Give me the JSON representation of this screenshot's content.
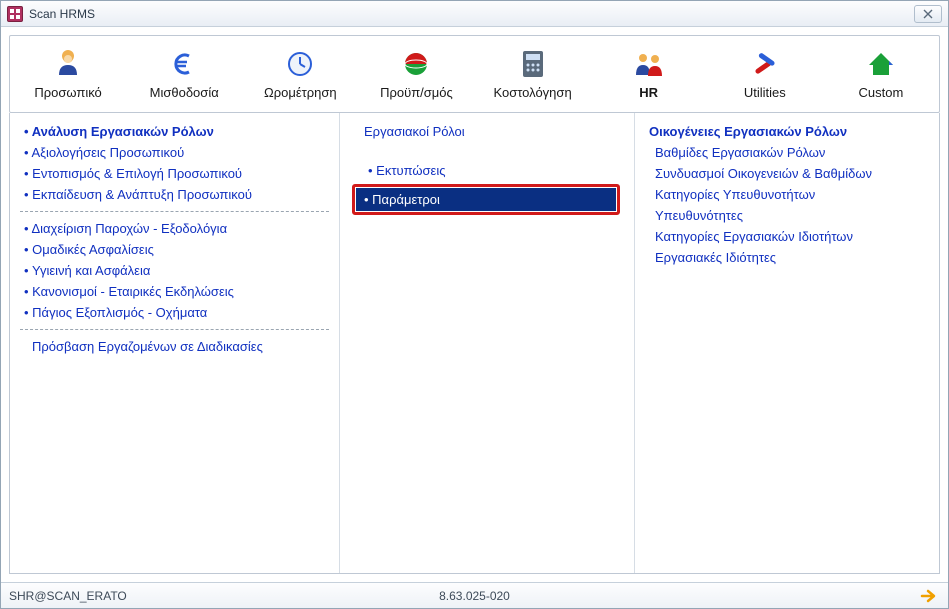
{
  "window": {
    "title": "Scan HRMS"
  },
  "toolbar": {
    "items": [
      {
        "key": "personnel",
        "label": "Προσωπικό"
      },
      {
        "key": "payroll",
        "label": "Μισθοδοσία"
      },
      {
        "key": "time",
        "label": "Ωρομέτρηση"
      },
      {
        "key": "budget",
        "label": "Προϋπ/σμός"
      },
      {
        "key": "costing",
        "label": "Κοστολόγηση"
      },
      {
        "key": "hr",
        "label": "HR"
      },
      {
        "key": "utilities",
        "label": "Utilities"
      },
      {
        "key": "custom",
        "label": "Custom"
      }
    ],
    "active": "hr"
  },
  "left_panel": {
    "group1": [
      {
        "label": "Ανάλυση Εργασιακών Ρόλων",
        "bold": true
      },
      {
        "label": "Αξιολογήσεις Προσωπικού"
      },
      {
        "label": "Εντοπισμός & Επιλογή Προσωπικού"
      },
      {
        "label": "Εκπαίδευση & Ανάπτυξη Προσωπικού"
      }
    ],
    "group2": [
      {
        "label": "Διαχείριση Παροχών - Εξοδολόγια"
      },
      {
        "label": "Ομαδικές Ασφαλίσεις"
      },
      {
        "label": "Υγιεινή και Ασφάλεια"
      },
      {
        "label": "Κανονισμοί - Εταιρικές Εκδηλώσεις"
      },
      {
        "label": "Πάγιος Εξοπλισμός - Οχήματα"
      }
    ],
    "group3": [
      {
        "label": "Πρόσβαση Εργαζομένων σε Διαδικασίες"
      }
    ]
  },
  "mid_panel": {
    "header": "Εργασιακοί Ρόλοι",
    "items": [
      {
        "label": "Εκτυπώσεις"
      },
      {
        "label": "Παράμετροι",
        "selected": true,
        "highlight": true
      }
    ]
  },
  "right_panel": {
    "header": "Οικογένειες Εργασιακών Ρόλων",
    "items": [
      {
        "label": "Βαθμίδες Εργασιακών Ρόλων"
      },
      {
        "label": "Συνδυασμοί Οικογενειών & Βαθμίδων"
      },
      {
        "label": "Κατηγορίες Υπευθυνοτήτων"
      },
      {
        "label": "Υπευθυνότητες"
      },
      {
        "label": "Κατηγορίες Εργασιακών Ιδιοτήτων"
      },
      {
        "label": "Εργασιακές Ιδιότητες"
      }
    ]
  },
  "statusbar": {
    "left": "SHR@SCAN_ERATO",
    "center": "8.63.025-020"
  }
}
